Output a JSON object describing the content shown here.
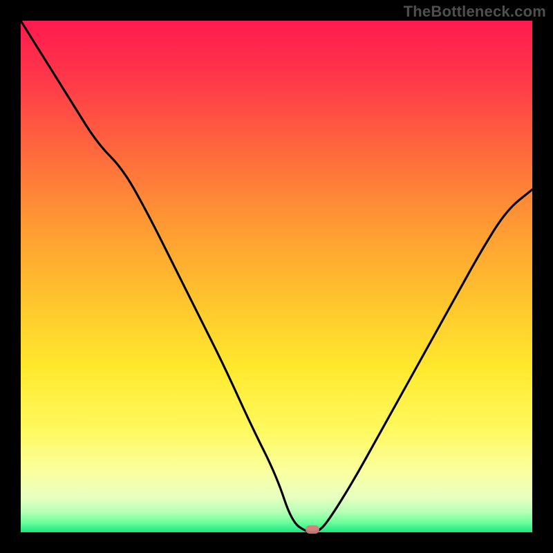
{
  "watermark": "TheBottleneck.com",
  "chart_data": {
    "type": "line",
    "title": "",
    "xlabel": "",
    "ylabel": "",
    "xlim": [
      0,
      100
    ],
    "ylim": [
      0,
      100
    ],
    "notes": "Bottleneck-style V-curve over red→green vertical gradient; minimum near x≈56 at y≈0; small rounded marker at the minimum.",
    "series": [
      {
        "name": "bottleneck-curve",
        "x": [
          0,
          5,
          10,
          15,
          20,
          25,
          30,
          35,
          40,
          45,
          50,
          53,
          56,
          58,
          60,
          65,
          70,
          75,
          80,
          85,
          90,
          95,
          100
        ],
        "values": [
          100,
          92,
          84,
          76,
          71,
          62,
          52,
          42,
          32,
          21,
          11,
          2,
          0,
          0,
          2,
          10,
          19,
          28,
          37,
          46,
          55,
          63,
          67
        ]
      }
    ],
    "marker": {
      "x": 57,
      "y": 0
    },
    "gradient_stops": [
      {
        "pos": 0,
        "color": "#ff1a50"
      },
      {
        "pos": 26,
        "color": "#ff6a3d"
      },
      {
        "pos": 54,
        "color": "#ffc22e"
      },
      {
        "pos": 80,
        "color": "#fff95f"
      },
      {
        "pos": 100,
        "color": "#17e981"
      }
    ]
  }
}
